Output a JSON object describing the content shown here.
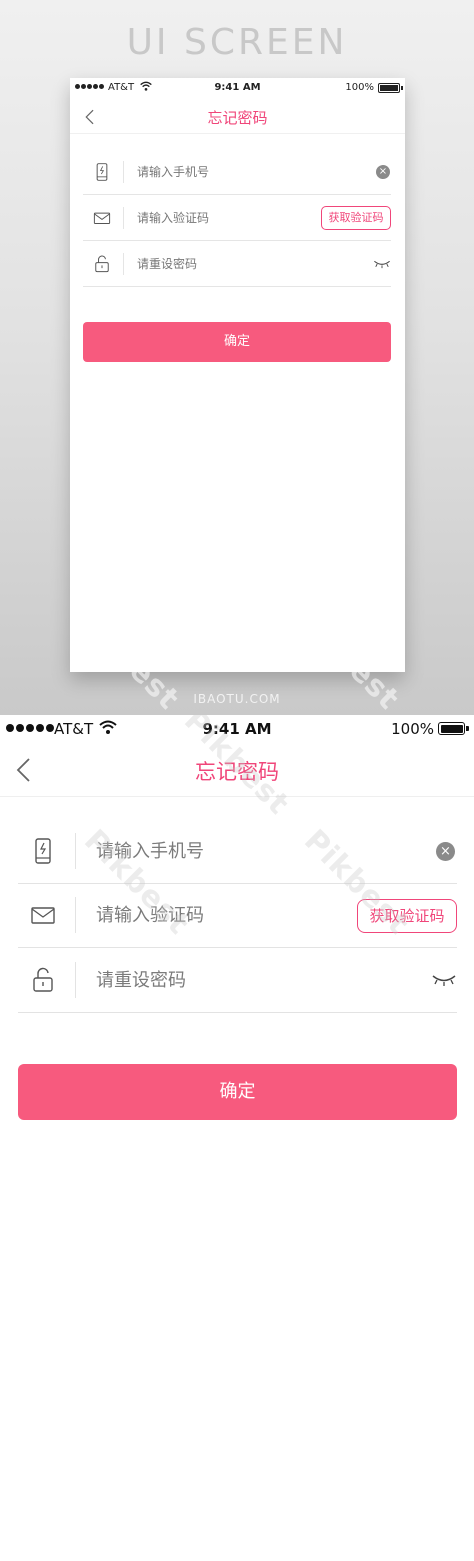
{
  "showcase": {
    "heading": "UI SCREEN",
    "footer": "IBAOTU.COM",
    "watermark": "Pikbest"
  },
  "status_bar": {
    "carrier": "AT&T",
    "time": "9:41 AM",
    "battery": "100%",
    "signal_icon": "signal-dots-icon",
    "wifi_icon": "wifi-icon",
    "battery_icon": "battery-icon"
  },
  "nav": {
    "title": "忘记密码",
    "back_icon": "chevron-left-icon"
  },
  "form": {
    "phone": {
      "placeholder": "请输入手机号",
      "value": "",
      "icon": "phone-icon",
      "action_icon": "clear-icon",
      "action_glyph": "×"
    },
    "code": {
      "placeholder": "请输入验证码",
      "value": "",
      "icon": "mail-icon",
      "button_label": "获取验证码"
    },
    "password": {
      "placeholder": "请重设密码",
      "value": "",
      "icon": "unlock-icon",
      "action_icon": "eye-closed-icon"
    }
  },
  "confirm_label": "确定",
  "colors": {
    "accent": "#f0467a",
    "button": "#f75a7e",
    "divider": "#e3e3e3",
    "placeholder": "#7b7b7b"
  }
}
